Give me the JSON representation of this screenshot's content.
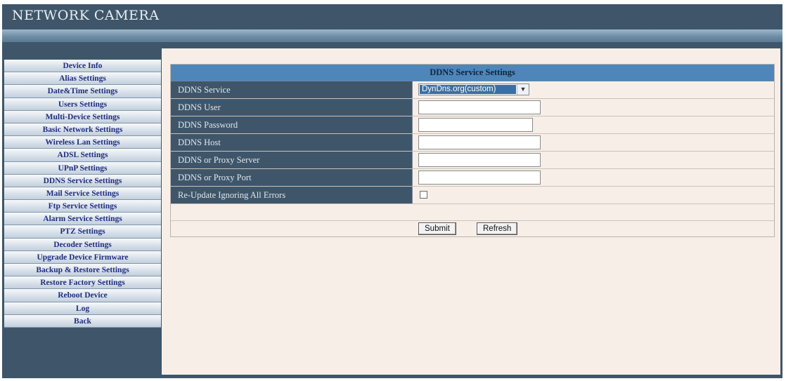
{
  "app": {
    "title": "NETWORK CAMERA"
  },
  "sidebar": {
    "items": [
      "Device Info",
      "Alias Settings",
      "Date&Time Settings",
      "Users Settings",
      "Multi-Device Settings",
      "Basic Network Settings",
      "Wireless Lan Settings",
      "ADSL Settings",
      "UPnP Settings",
      "DDNS Service Settings",
      "Mail Service Settings",
      "Ftp Service Settings",
      "Alarm Service Settings",
      "PTZ Settings",
      "Decoder Settings",
      "Upgrade Device Firmware",
      "Backup & Restore Settings",
      "Restore Factory Settings",
      "Reboot Device",
      "Log",
      "Back"
    ]
  },
  "panel": {
    "title": "DDNS Service Settings",
    "fields": {
      "service": {
        "label": "DDNS Service",
        "value": "DynDns.org(custom)"
      },
      "user": {
        "label": "DDNS User",
        "value": ""
      },
      "password": {
        "label": "DDNS Password",
        "value": ""
      },
      "host": {
        "label": "DDNS Host",
        "value": ""
      },
      "proxy_server": {
        "label": "DDNS or Proxy Server",
        "value": ""
      },
      "proxy_port": {
        "label": "DDNS or Proxy Port",
        "value": ""
      },
      "reupdate": {
        "label": "Re-Update Ignoring All Errors",
        "checked": false
      }
    },
    "buttons": {
      "submit": "Submit",
      "refresh": "Refresh"
    }
  },
  "icons": {
    "select_arrow": "chevron-down-icon"
  }
}
